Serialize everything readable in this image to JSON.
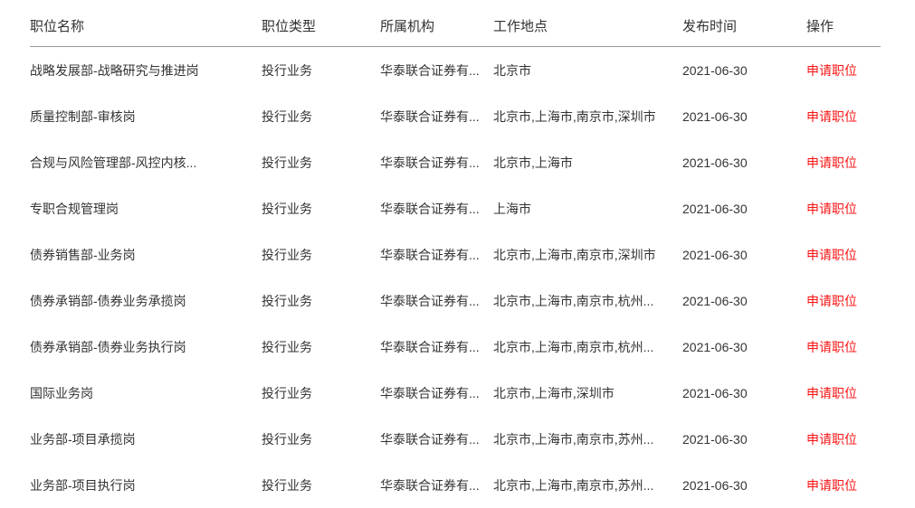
{
  "table": {
    "columns": [
      {
        "key": "title",
        "label": "职位名称"
      },
      {
        "key": "type",
        "label": "职位类型"
      },
      {
        "key": "org",
        "label": "所属机构"
      },
      {
        "key": "loc",
        "label": "工作地点"
      },
      {
        "key": "date",
        "label": "发布时间"
      },
      {
        "key": "action",
        "label": "操作"
      }
    ],
    "action_label": "申请职位",
    "action_color": "#fa1414",
    "divider_color": "#9a9a9e",
    "rows": [
      {
        "title": "战略发展部-战略研究与推进岗",
        "type": "投行业务",
        "org": "华泰联合证券有...",
        "loc": "北京市",
        "date": "2021-06-30",
        "action": "申请职位"
      },
      {
        "title": "质量控制部-审核岗",
        "type": "投行业务",
        "org": "华泰联合证券有...",
        "loc": "北京市,上海市,南京市,深圳市",
        "date": "2021-06-30",
        "action": "申请职位"
      },
      {
        "title": "合规与风险管理部-风控内核...",
        "type": "投行业务",
        "org": "华泰联合证券有...",
        "loc": "北京市,上海市",
        "date": "2021-06-30",
        "action": "申请职位"
      },
      {
        "title": "专职合规管理岗",
        "type": "投行业务",
        "org": "华泰联合证券有...",
        "loc": "上海市",
        "date": "2021-06-30",
        "action": "申请职位"
      },
      {
        "title": "债券销售部-业务岗",
        "type": "投行业务",
        "org": "华泰联合证券有...",
        "loc": "北京市,上海市,南京市,深圳市",
        "date": "2021-06-30",
        "action": "申请职位"
      },
      {
        "title": "债券承销部-债券业务承揽岗",
        "type": "投行业务",
        "org": "华泰联合证券有...",
        "loc": "北京市,上海市,南京市,杭州...",
        "date": "2021-06-30",
        "action": "申请职位"
      },
      {
        "title": "债券承销部-债券业务执行岗",
        "type": "投行业务",
        "org": "华泰联合证券有...",
        "loc": "北京市,上海市,南京市,杭州...",
        "date": "2021-06-30",
        "action": "申请职位"
      },
      {
        "title": "国际业务岗",
        "type": "投行业务",
        "org": "华泰联合证券有...",
        "loc": "北京市,上海市,深圳市",
        "date": "2021-06-30",
        "action": "申请职位"
      },
      {
        "title": "业务部-项目承揽岗",
        "type": "投行业务",
        "org": "华泰联合证券有...",
        "loc": "北京市,上海市,南京市,苏州...",
        "date": "2021-06-30",
        "action": "申请职位"
      },
      {
        "title": "业务部-项目执行岗",
        "type": "投行业务",
        "org": "华泰联合证券有...",
        "loc": "北京市,上海市,南京市,苏州...",
        "date": "2021-06-30",
        "action": "申请职位"
      }
    ]
  }
}
